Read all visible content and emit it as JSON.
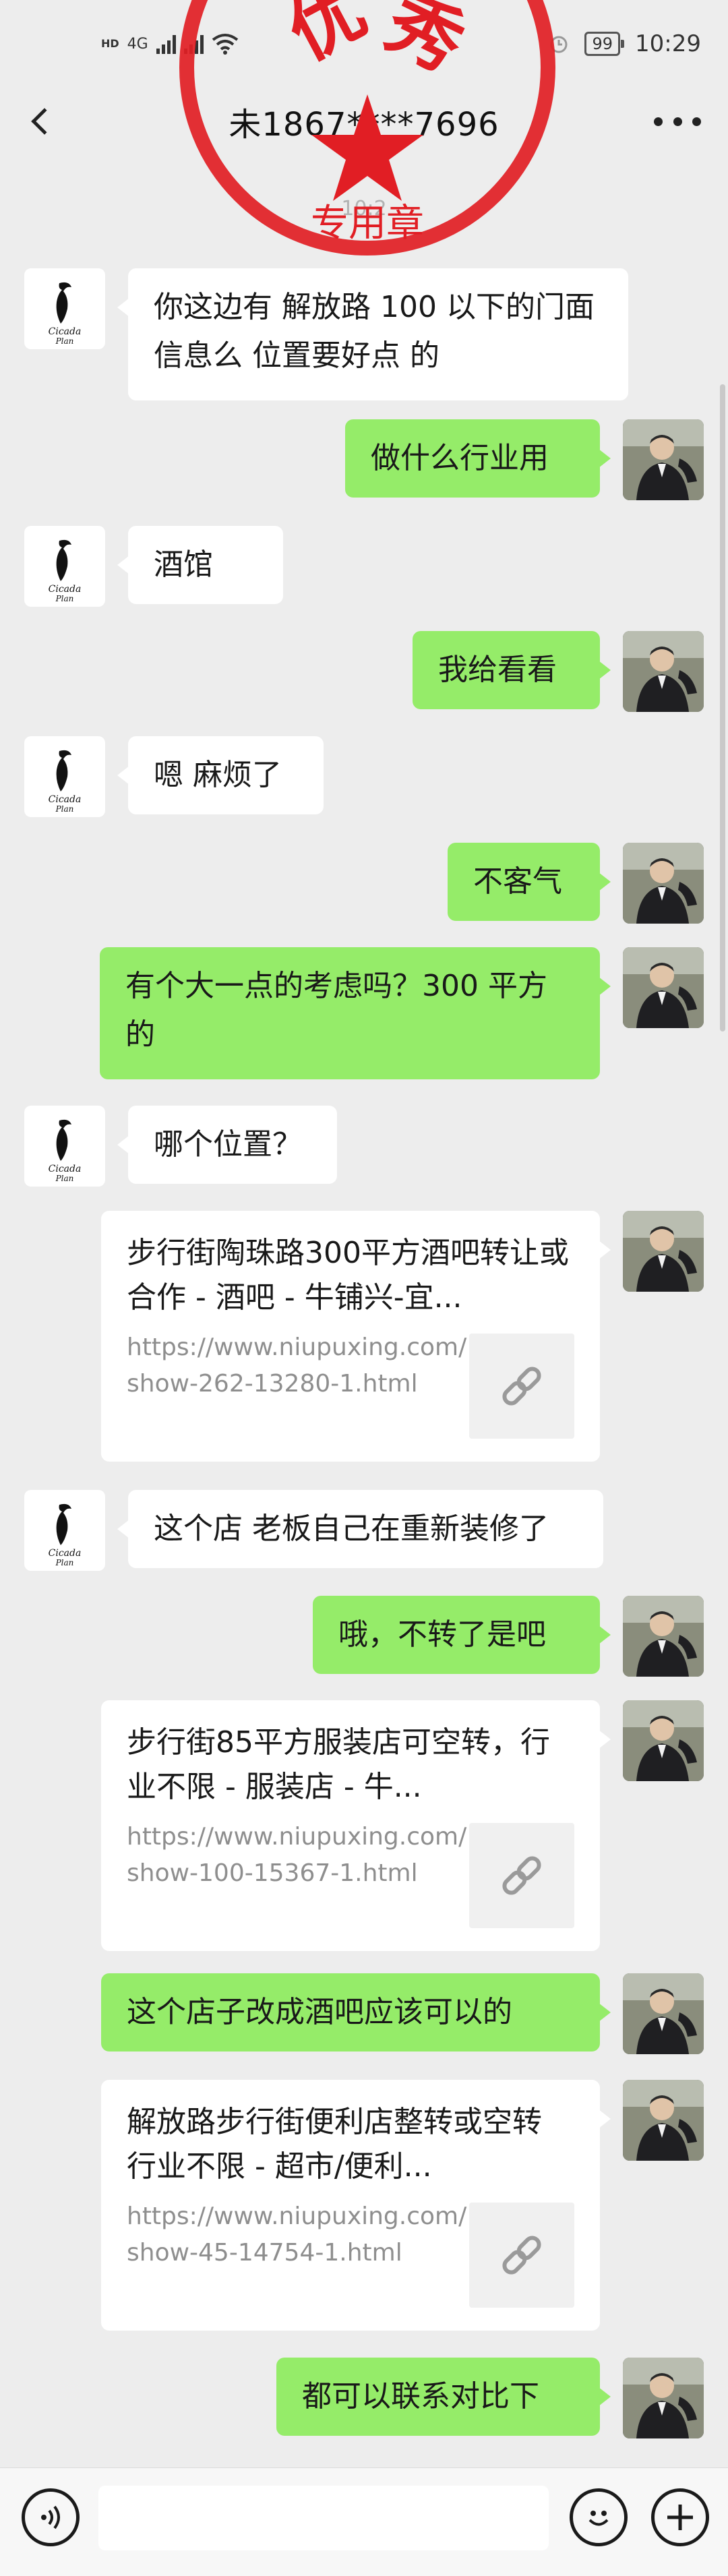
{
  "status_bar": {
    "hd_label": "HD",
    "network_label": "4G",
    "battery_level": "99",
    "time": "10:29"
  },
  "header": {
    "title": "未1867****7696",
    "timestamp": "10:2"
  },
  "seal": {
    "top_text": "优秀",
    "bottom_text": "专用章",
    "color": "#e11e24"
  },
  "colors": {
    "sent_bubble": "#95ec69",
    "received_bubble": "#ffffff",
    "background": "#ededed"
  },
  "contact_avatar": {
    "line1": "Cicada",
    "line2": "Plan"
  },
  "messages": [
    {
      "side": "left",
      "type": "text",
      "text": "你这边有 解放路 100 以下的门面信息么  位置要好点  的"
    },
    {
      "side": "right",
      "type": "text",
      "text": "做什么行业用"
    },
    {
      "side": "left",
      "type": "text",
      "text": "酒馆"
    },
    {
      "side": "right",
      "type": "text",
      "text": "我给看看"
    },
    {
      "side": "left",
      "type": "text",
      "text": "嗯 麻烦了"
    },
    {
      "side": "right",
      "type": "text",
      "text": "不客气"
    },
    {
      "side": "right",
      "type": "text",
      "text": "有个大一点的考虑吗？300 平方的"
    },
    {
      "side": "left",
      "type": "text",
      "text": "哪个位置？"
    },
    {
      "side": "right",
      "type": "link",
      "title": "步行街陶珠路300平方酒吧转让或合作 - 酒吧 - 牛铺兴-宜...",
      "url": "https://www.niupuxing.com/show-262-13280-1.html"
    },
    {
      "side": "left",
      "type": "text",
      "text": "这个店  老板自己在重新装修了"
    },
    {
      "side": "right",
      "type": "text",
      "text": "哦，不转了是吧"
    },
    {
      "side": "right",
      "type": "link",
      "title": "步行街85平方服装店可空转，行业不限 - 服装店 - 牛...",
      "url": "https://www.niupuxing.com/show-100-15367-1.html"
    },
    {
      "side": "right",
      "type": "text",
      "text": "这个店子改成酒吧应该可以的"
    },
    {
      "side": "right",
      "type": "link",
      "title": "解放路步行街便利店整转或空转 行业不限 - 超市/便利...",
      "url": "https://www.niupuxing.com/show-45-14754-1.html"
    },
    {
      "side": "right",
      "type": "text",
      "text": "都可以联系对比下"
    }
  ],
  "input_bar": {
    "placeholder": ""
  }
}
